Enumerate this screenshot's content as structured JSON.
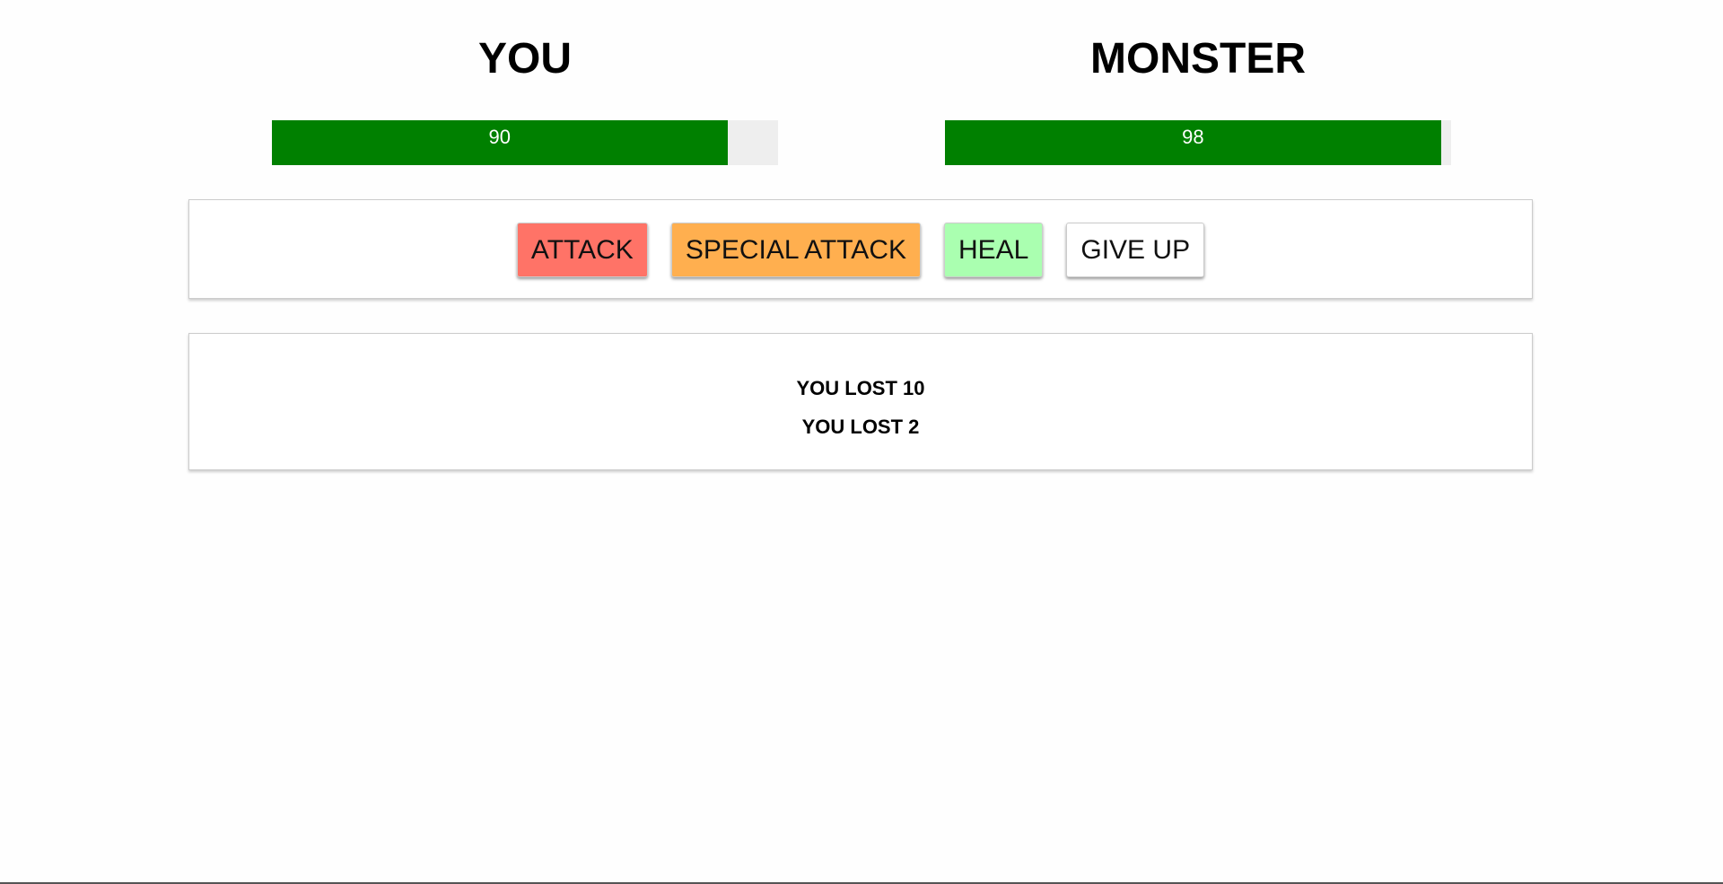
{
  "players": [
    {
      "id": "you",
      "name": "YOU",
      "health": 90,
      "health_label": "90",
      "bar_color": "#008000"
    },
    {
      "id": "monster",
      "name": "MONSTER",
      "health": 98,
      "health_label": "98",
      "bar_color": "#008000"
    }
  ],
  "controls": {
    "attack_label": "ATTACK",
    "special_attack_label": "SPECIAL ATTACK",
    "heal_label": "HEAL",
    "give_up_label": "GIVE UP",
    "colors": {
      "attack": "#ff7367",
      "special_attack": "#ffaf4f",
      "heal": "#aaffb0",
      "give_up": "#ffffff"
    }
  },
  "log": [
    "YOU LOST 10",
    "YOU LOST 2"
  ]
}
